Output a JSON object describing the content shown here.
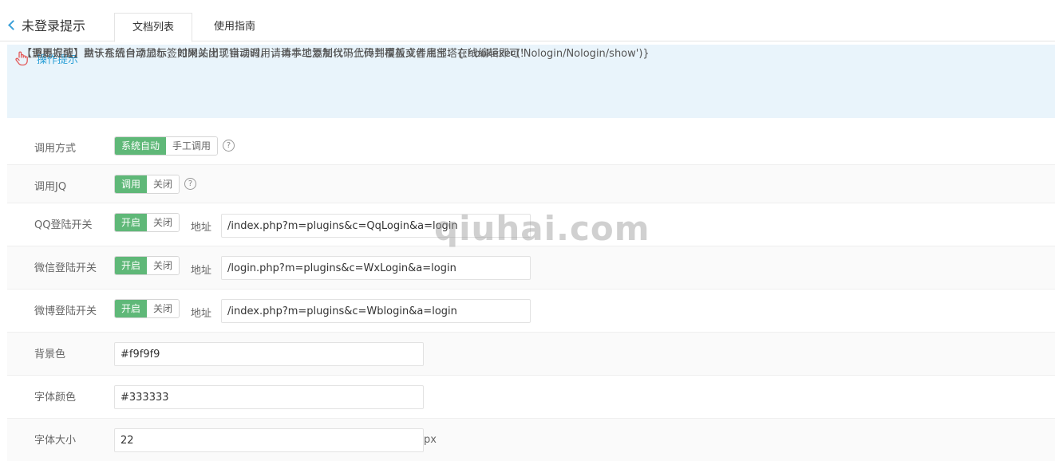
{
  "header": {
    "back_title": "未登录提示",
    "tabs": [
      {
        "label": "文档列表",
        "active": true
      },
      {
        "label": "使用指南",
        "active": false
      }
    ]
  },
  "tips": {
    "title": "操作提示",
    "lines": [
      "【调用方法】默认系统自动显示，如果关闭了自动调用，请手工复制以下代码到模板文件底部：{:hookexec('Nologin/Nologin/show')}",
      "【重要提醒】由于在后台添加标签时网站出现错误时，请再本地添加代码上传并覆盖或者用宝塔在线编辑即可！"
    ]
  },
  "form": {
    "call_mode": {
      "label": "调用方式",
      "options": [
        "系统自动",
        "手工调用"
      ],
      "selected": "系统自动"
    },
    "call_jq": {
      "label": "调用JQ",
      "options": [
        "调用",
        "关闭"
      ],
      "selected": "调用"
    },
    "qq_login": {
      "label": "QQ登陆开关",
      "options": [
        "开启",
        "关闭"
      ],
      "selected": "开启",
      "addr_label": "地址",
      "addr_value": "/index.php?m=plugins&c=QqLogin&a=login"
    },
    "wx_login": {
      "label": "微信登陆开关",
      "options": [
        "开启",
        "关闭"
      ],
      "selected": "开启",
      "addr_label": "地址",
      "addr_value": "/login.php?m=plugins&c=WxLogin&a=login"
    },
    "wb_login": {
      "label": "微博登陆开关",
      "options": [
        "开启",
        "关闭"
      ],
      "selected": "开启",
      "addr_label": "地址",
      "addr_value": "/index.php?m=plugins&c=Wblogin&a=login"
    },
    "bg_color": {
      "label": "背景色",
      "value": "#f9f9f9"
    },
    "font_color": {
      "label": "字体颜色",
      "value": "#333333"
    },
    "font_size": {
      "label": "字体大小",
      "value": "22",
      "unit": "px"
    }
  },
  "help_glyph": "?",
  "watermark": "qiuhai.com",
  "colors": {
    "accent": "#5fb878",
    "link": "#2a9fd6",
    "tips_bg": "#e9f4fb"
  }
}
